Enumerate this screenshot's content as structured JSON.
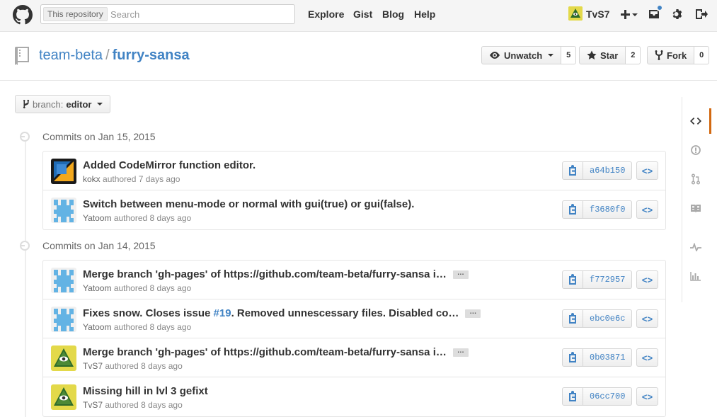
{
  "header": {
    "search_scope": "This repository",
    "search_placeholder": "Search",
    "nav": [
      "Explore",
      "Gist",
      "Blog",
      "Help"
    ],
    "user": "TvS7"
  },
  "repo": {
    "owner": "team-beta",
    "separator": "/",
    "name": "furry-sansa",
    "unwatch_label": "Unwatch",
    "watch_count": "5",
    "star_label": "Star",
    "star_count": "2",
    "fork_label": "Fork",
    "fork_count": "0"
  },
  "branch": {
    "label": "branch:",
    "name": "editor"
  },
  "groups": [
    {
      "date_label": "Commits on Jan 15, 2015",
      "commits": [
        {
          "message": "Added CodeMirror function editor.",
          "author": "kokx",
          "time": "authored 7 days ago",
          "sha": "a64b150",
          "avatar": "kokx",
          "truncated": false
        },
        {
          "message": "Switch between menu-mode or normal with gui(true) or gui(false).",
          "author": "Yatoom",
          "time": "authored 8 days ago",
          "sha": "f3680f0",
          "avatar": "yatoom",
          "truncated": false
        }
      ]
    },
    {
      "date_label": "Commits on Jan 14, 2015",
      "commits": [
        {
          "message": "Merge branch 'gh-pages' of https://github.com/team-beta/furry-sansa i…",
          "author": "Yatoom",
          "time": "authored 8 days ago",
          "sha": "f772957",
          "avatar": "yatoom",
          "truncated": true
        },
        {
          "message_pre": "Fixes snow. Closes issue ",
          "message_link": "#19",
          "message_post": ". Removed unnescessary files. Disabled co…",
          "author": "Yatoom",
          "time": "authored 8 days ago",
          "sha": "ebc0e6c",
          "avatar": "yatoom",
          "truncated": true
        },
        {
          "message": "Merge branch 'gh-pages' of https://github.com/team-beta/furry-sansa i…",
          "author": "TvS7",
          "time": "authored 8 days ago",
          "sha": "0b03871",
          "avatar": "tvs7",
          "truncated": true
        },
        {
          "message": "Missing hill in lvl 3 gefixt",
          "author": "TvS7",
          "time": "authored 8 days ago",
          "sha": "06cc700",
          "avatar": "tvs7",
          "truncated": false
        }
      ]
    }
  ],
  "ellipsis": "…",
  "browse_label": "<>",
  "sidenav": [
    "code-icon",
    "issues-icon",
    "pull-requests-icon",
    "wiki-icon",
    "pulse-icon",
    "graphs-icon"
  ],
  "colors": {
    "link": "#4183c4",
    "active_tab": "#d26911"
  }
}
